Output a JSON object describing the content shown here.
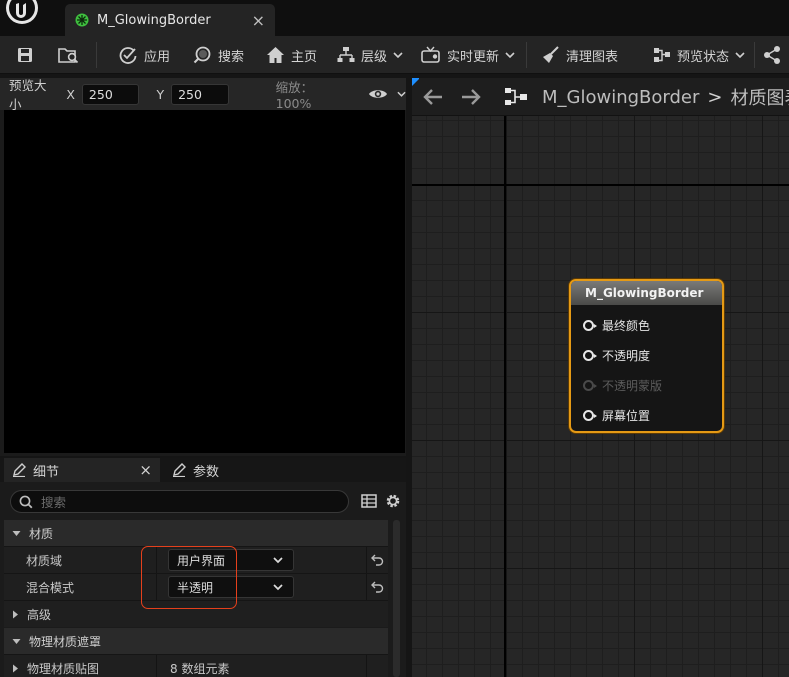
{
  "tab": {
    "title": "M_GlowingBorder",
    "close": "×"
  },
  "toolbar": {
    "apply": "应用",
    "search": "搜索",
    "home": "主页",
    "hierarchy": "层级",
    "live_update": "实时更新",
    "clean_graph": "清理图表",
    "preview_state": "预览状态"
  },
  "preview": {
    "size_label": "预览大小",
    "x_label": "X",
    "x_value": "250",
    "y_label": "Y",
    "y_value": "250",
    "zoom": "缩放：100%"
  },
  "details": {
    "tab_details": "细节",
    "tab_details_close": "×",
    "tab_params": "参数",
    "search_placeholder": "搜索",
    "section_material": "材质",
    "material_domain_label": "材质域",
    "material_domain_value": "用户界面",
    "blend_mode_label": "混合模式",
    "blend_mode_value": "半透明",
    "section_advanced": "高级",
    "section_physical_mask": "物理材质遮罩",
    "physical_map_label": "物理材质贴图",
    "physical_map_value": "8 数组元素"
  },
  "graph": {
    "breadcrumb_asset": "M_GlowingBorder",
    "breadcrumb_sep": ">",
    "breadcrumb_graph": "材质图表"
  },
  "node": {
    "title": "M_GlowingBorder",
    "pins": [
      {
        "label": "最终颜色",
        "enabled": true
      },
      {
        "label": "不透明度",
        "enabled": true
      },
      {
        "label": "不透明蒙版",
        "enabled": false
      },
      {
        "label": "屏幕位置",
        "enabled": true
      }
    ]
  },
  "colors": {
    "node_border": "#e59a15",
    "highlight_box": "#e5401c",
    "tab_icon": "#3fbf3f"
  }
}
